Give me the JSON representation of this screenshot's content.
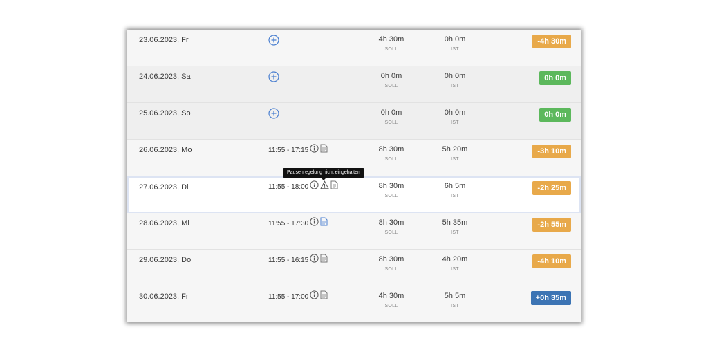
{
  "rows": [
    {
      "date": "23.06.2023, Fr",
      "soll": "4h 30m",
      "soll_label": "SOLL",
      "ist": "0h 0m",
      "ist_label": "IST",
      "diff": "-4h 30m"
    },
    {
      "date": "24.06.2023, Sa",
      "soll": "0h 0m",
      "soll_label": "SOLL",
      "ist": "0h 0m",
      "ist_label": "IST",
      "diff": "0h 0m"
    },
    {
      "date": "25.06.2023, So",
      "soll": "0h 0m",
      "soll_label": "SOLL",
      "ist": "0h 0m",
      "ist_label": "IST",
      "diff": "0h 0m"
    },
    {
      "date": "26.06.2023, Mo",
      "time": "11:55 - 17:15",
      "soll": "8h 30m",
      "soll_label": "SOLL",
      "ist": "5h 20m",
      "ist_label": "IST",
      "diff": "-3h 10m"
    },
    {
      "date": "27.06.2023, Di",
      "time": "11:55 - 18:00",
      "soll": "8h 30m",
      "soll_label": "SOLL",
      "ist": "6h 5m",
      "ist_label": "IST",
      "diff": "-2h 25m"
    },
    {
      "date": "28.06.2023, Mi",
      "time": "11:55 - 17:30",
      "soll": "8h 30m",
      "soll_label": "SOLL",
      "ist": "5h 35m",
      "ist_label": "IST",
      "diff": "-2h 55m"
    },
    {
      "date": "29.06.2023, Do",
      "time": "11:55 - 16:15",
      "soll": "8h 30m",
      "soll_label": "SOLL",
      "ist": "4h 20m",
      "ist_label": "IST",
      "diff": "-4h 10m"
    },
    {
      "date": "30.06.2023, Fr",
      "time": "11:55 - 17:00",
      "soll": "4h 30m",
      "soll_label": "SOLL",
      "ist": "5h 5m",
      "ist_label": "IST",
      "diff": "+0h 35m"
    }
  ],
  "tooltip": "Pausenregelung nicht eingehalten",
  "colors": {
    "negative": "#e8a94a",
    "zero": "#5cb85c",
    "positive": "#3c74b4",
    "add_icon": "#4a7fd0",
    "doc_icon_active": "#4a7fd0"
  },
  "icons": {
    "add": "plus-circle-icon",
    "info": "info-icon",
    "warning": "warning-icon",
    "document": "document-icon"
  }
}
